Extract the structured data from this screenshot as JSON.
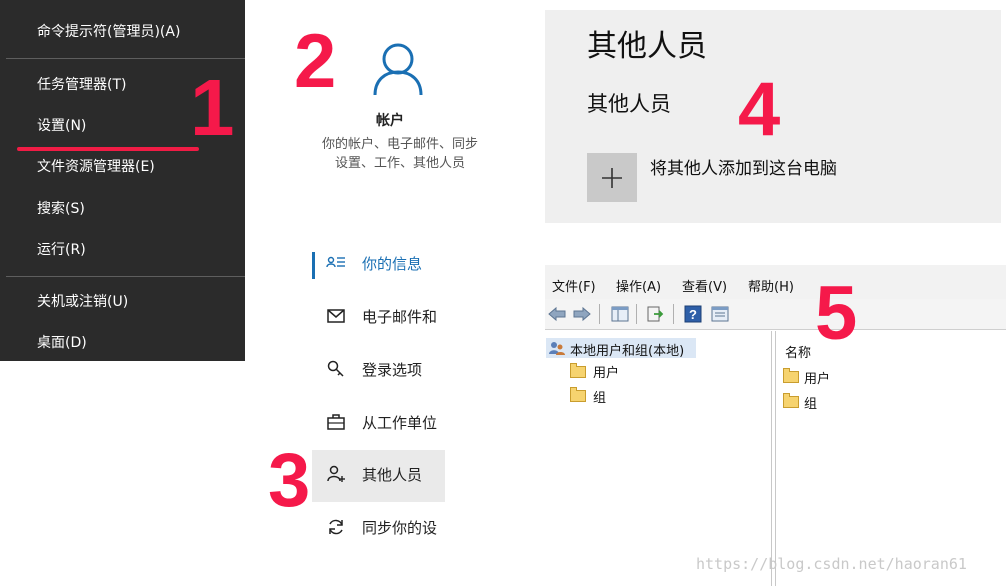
{
  "steps": {
    "s1": "1",
    "s2": "2",
    "s3": "3",
    "s4": "4",
    "s5": "5"
  },
  "winx_menu": {
    "items": [
      {
        "label": "命令提示符(管理员)(A)"
      },
      {
        "label": "任务管理器(T)"
      },
      {
        "label": "设置(N)"
      },
      {
        "label": "文件资源管理器(E)"
      },
      {
        "label": "搜索(S)"
      },
      {
        "label": "运行(R)"
      },
      {
        "label": "关机或注销(U)"
      },
      {
        "label": "桌面(D)"
      }
    ],
    "highlight_color": "#f01c45"
  },
  "account_tile": {
    "icon": "person-icon",
    "title": "帐户",
    "desc_line1": "你的帐户、电子邮件、同步",
    "desc_line2": "设置、工作、其他人员"
  },
  "settings_nav": {
    "items": [
      {
        "icon": "contact-card-icon",
        "label": "你的信息"
      },
      {
        "icon": "mail-icon",
        "label": "电子邮件和"
      },
      {
        "icon": "key-icon",
        "label": "登录选项"
      },
      {
        "icon": "briefcase-icon",
        "label": "从工作单位"
      },
      {
        "icon": "add-person-icon",
        "label": "其他人员"
      },
      {
        "icon": "sync-icon",
        "label": "同步你的设"
      }
    ],
    "active_index": 0,
    "selected_index": 4,
    "accent": "#1a6fb3"
  },
  "other_users": {
    "heading": "其他人员",
    "subheading": "其他人员",
    "add_label": "将其他人添加到这台电脑",
    "plus_icon": "plus-icon"
  },
  "lusrmgr": {
    "menu": [
      "文件(F)",
      "操作(A)",
      "查看(V)",
      "帮助(H)"
    ],
    "toolbar_icons": [
      "back-icon",
      "forward-icon",
      "show-tree-icon",
      "export-icon",
      "help-icon",
      "properties-icon"
    ],
    "tree_root": "本地用户和组(本地)",
    "tree_children": [
      "用户",
      "组"
    ],
    "list_header": "名称",
    "list_items": [
      "用户",
      "组"
    ]
  },
  "watermark": "https://blog.csdn.net/haoran61"
}
